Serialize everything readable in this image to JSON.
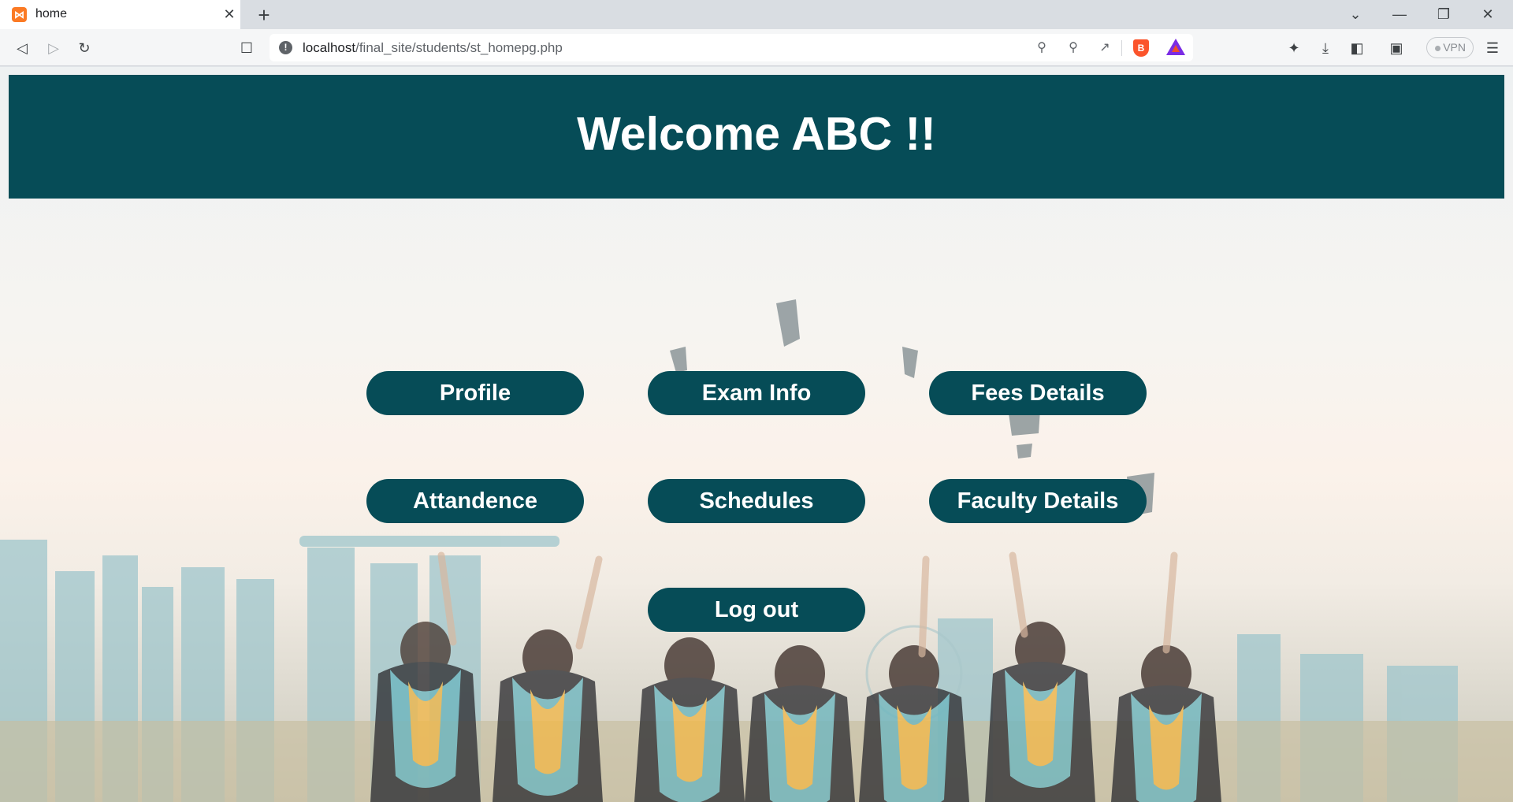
{
  "browser": {
    "tab_title": "home",
    "tab_favicon": "xampp-icon",
    "url_host": "localhost",
    "url_path": "/final_site/students/st_homepg.php",
    "vpn_label": "VPN"
  },
  "page": {
    "welcome_title": "Welcome ABC !!",
    "buttons": {
      "profile": "Profile",
      "exam_info": "Exam Info",
      "fees_details": "Fees Details",
      "attendence": "Attandence",
      "schedules": "Schedules",
      "faculty_details": "Faculty Details",
      "logout": "Log out"
    }
  },
  "colors": {
    "banner": "#064c57",
    "button": "#064c57",
    "button_text": "#ffffff"
  }
}
